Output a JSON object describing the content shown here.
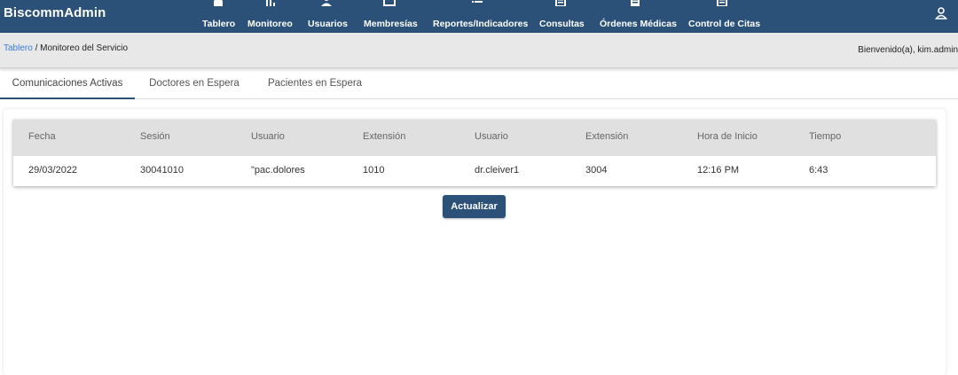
{
  "app": {
    "brand": "BiscommAdmin"
  },
  "nav": [
    {
      "label": "Tablero",
      "icon": "home-icon"
    },
    {
      "label": "Monitoreo",
      "icon": "bar-chart-icon"
    },
    {
      "label": "Usuarios",
      "icon": "users-icon"
    },
    {
      "label": "Membresías",
      "icon": "card-icon"
    },
    {
      "label": "Reportes/Indicadores",
      "icon": "list-icon"
    },
    {
      "label": "Consultas",
      "icon": "document-icon"
    },
    {
      "label": "Órdenes Médicas",
      "icon": "document-icon"
    },
    {
      "label": "Control de Citas",
      "icon": "document-icon"
    }
  ],
  "breadcrumb": {
    "link": "Tablero",
    "separator": " / ",
    "current": "Monitoreo del Servicio"
  },
  "welcome": "Bienvenido(a), kim.admin",
  "tabs": [
    {
      "label": "Comunicaciones Activas",
      "active": true
    },
    {
      "label": "Doctores en Espera",
      "active": false
    },
    {
      "label": "Pacientes en Espera",
      "active": false
    }
  ],
  "table": {
    "headers": [
      "Fecha",
      "Sesión",
      "Usuario",
      "Extensión",
      "Usuario",
      "Extensión",
      "Hora de Inicio",
      "Tiempo"
    ],
    "rows": [
      [
        "29/03/2022",
        "30041010",
        "\"pac.dolores",
        "1010",
        "dr.cleiver1",
        "3004",
        "12:16 PM",
        "6:43"
      ]
    ]
  },
  "refresh_button": "Actualizar",
  "colors": {
    "primary": "#2b5178",
    "link": "#3a7bd5",
    "header_bg": "#e0e0e0"
  }
}
